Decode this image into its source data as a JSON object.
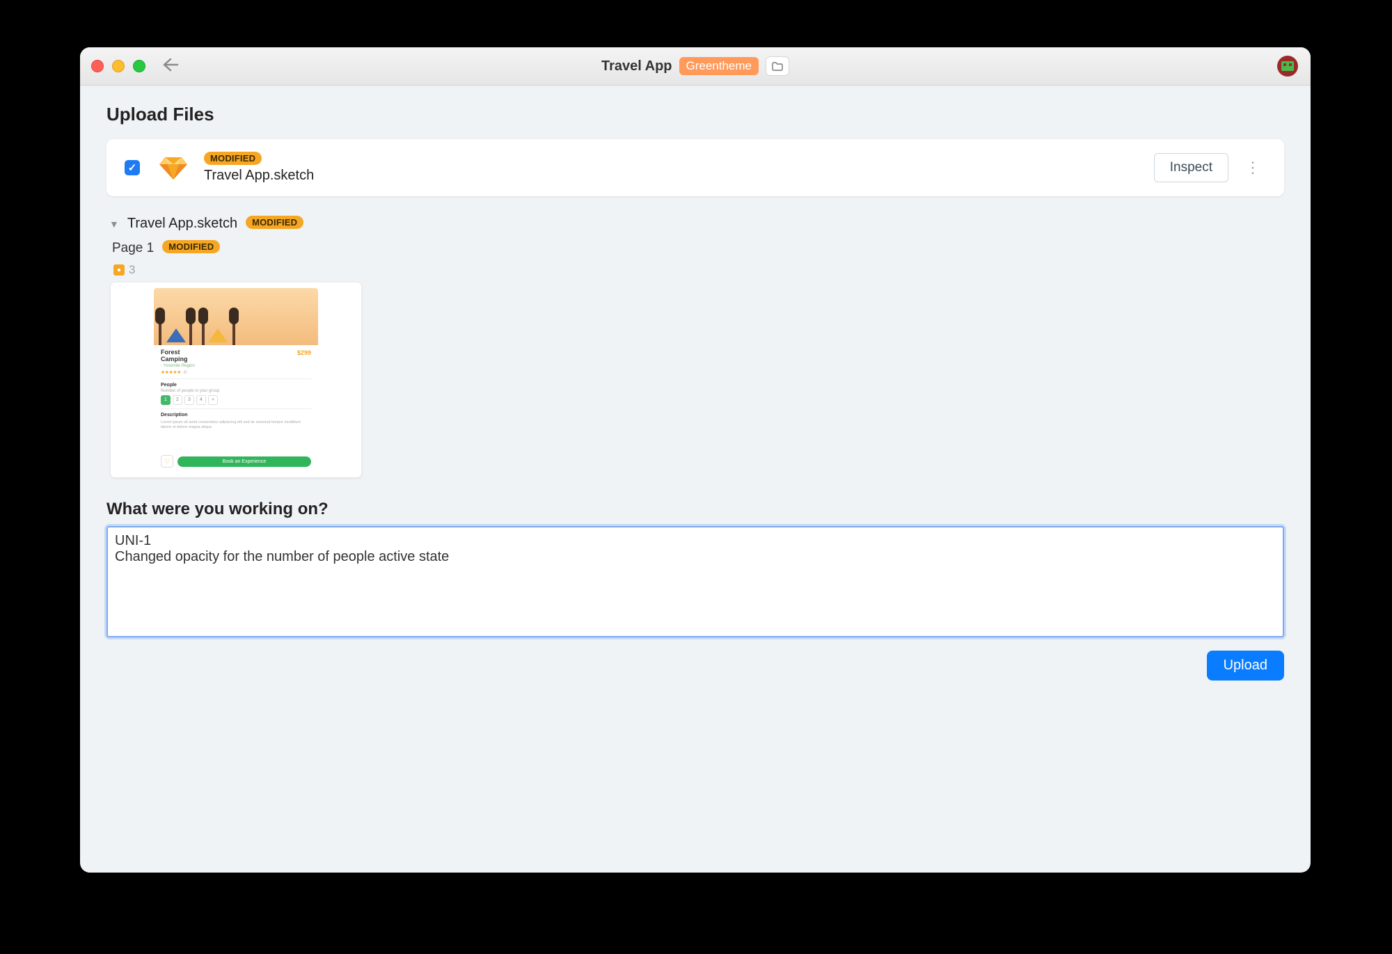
{
  "window": {
    "title": "Travel App",
    "branch_badge": "Greentheme"
  },
  "page": {
    "heading": "Upload Files"
  },
  "file_card": {
    "modified_badge": "MODIFIED",
    "filename": "Travel App.sketch",
    "inspect_label": "Inspect",
    "checked": true
  },
  "tree": {
    "file_label": "Travel App.sketch",
    "file_badge": "MODIFIED",
    "page_label": "Page 1",
    "page_badge": "MODIFIED",
    "artboard_count": "3"
  },
  "thumbnail": {
    "title": "Forest\nCamping",
    "price": "$299",
    "subtext": "◦ Yosemite Region",
    "stars": "★★★★★",
    "star_count": "47",
    "people_label": "People",
    "people_sub": "Number of people in your group",
    "pills": [
      "1",
      "2",
      "3",
      "4",
      "+"
    ],
    "desc_label": "Description",
    "desc_text": "Lorem ipsum sit amet consectetur adipiscing elit sed do eiusmod tempor incididunt labore et dolore magna aliqua",
    "book_label": "Book an Experience"
  },
  "comment": {
    "heading": "What were you working on?",
    "value": "UNI-1\nChanged opacity for the number of people active state"
  },
  "upload": {
    "label": "Upload"
  }
}
